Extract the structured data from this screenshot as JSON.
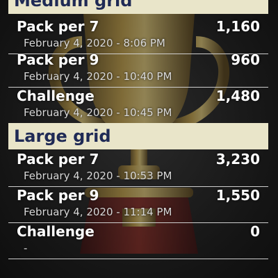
{
  "sections": [
    {
      "header": "Medium grid",
      "rows": [
        {
          "title": "Pack per 7",
          "date": "February 4, 2020 - 8:06 PM",
          "value": "1,160"
        },
        {
          "title": "Pack per 9",
          "date": "February 4, 2020 - 10:40 PM",
          "value": "960"
        },
        {
          "title": "Challenge",
          "date": "February 4, 2020 - 10:45 PM",
          "value": "1,480"
        }
      ]
    },
    {
      "header": "Large grid",
      "rows": [
        {
          "title": "Pack per 7",
          "date": "February 4, 2020 - 10:53 PM",
          "value": "3,230"
        },
        {
          "title": "Pack per 9",
          "date": "February 4, 2020 - 11:14 PM",
          "value": "1,550"
        },
        {
          "title": "Challenge",
          "date": "-",
          "value": "0"
        }
      ]
    }
  ],
  "colors": {
    "header_bg": "#e9e5c9",
    "header_text": "#1f2a55",
    "row_text": "#ffffff"
  },
  "background_icon": "trophy-icon"
}
